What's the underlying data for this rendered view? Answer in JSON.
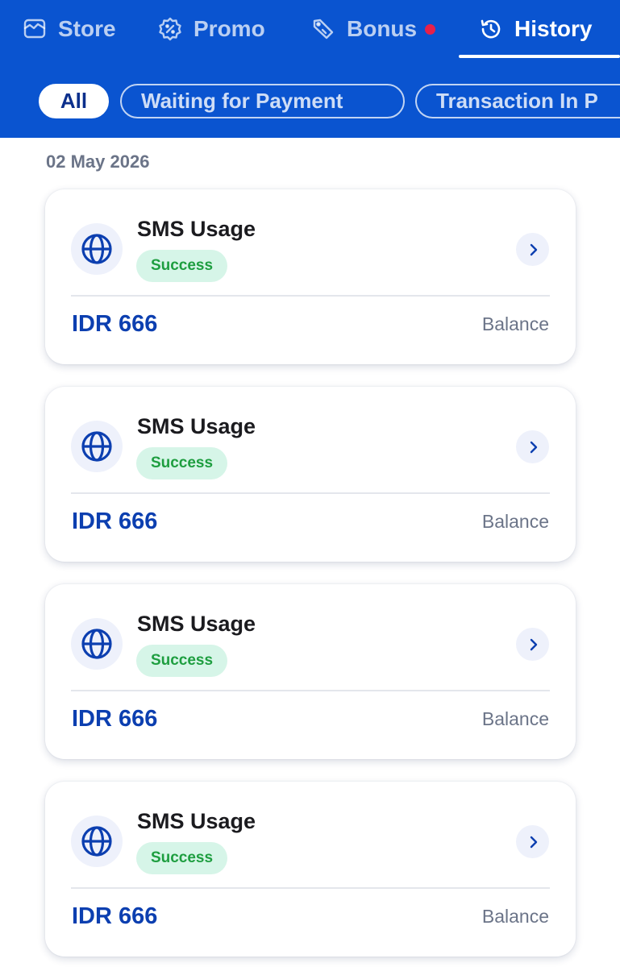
{
  "tabs": [
    {
      "label": "Store",
      "icon": "store-icon"
    },
    {
      "label": "Promo",
      "icon": "promo-icon"
    },
    {
      "label": "Bonus",
      "icon": "bonus-icon"
    },
    {
      "label": "History",
      "icon": "history-icon"
    }
  ],
  "active_tab": "History",
  "filters": [
    "All",
    "Waiting for Payment",
    "Transaction In P"
  ],
  "active_filter": "All",
  "date_group": "02 May 2026",
  "transactions": [
    {
      "title": "SMS Usage",
      "status": "Success",
      "amount": "IDR 666",
      "method": "Balance"
    },
    {
      "title": "SMS Usage",
      "status": "Success",
      "amount": "IDR 666",
      "method": "Balance"
    },
    {
      "title": "SMS Usage",
      "status": "Success",
      "amount": "IDR 666",
      "method": "Balance"
    },
    {
      "title": "SMS Usage",
      "status": "Success",
      "amount": "IDR 666",
      "method": "Balance"
    }
  ],
  "colors": {
    "header_bg": "#0a54d0",
    "amount": "#0c3fb0",
    "success_bg": "#d6f5e8",
    "success_text": "#1e9e40",
    "notification_dot": "#e6204a"
  }
}
